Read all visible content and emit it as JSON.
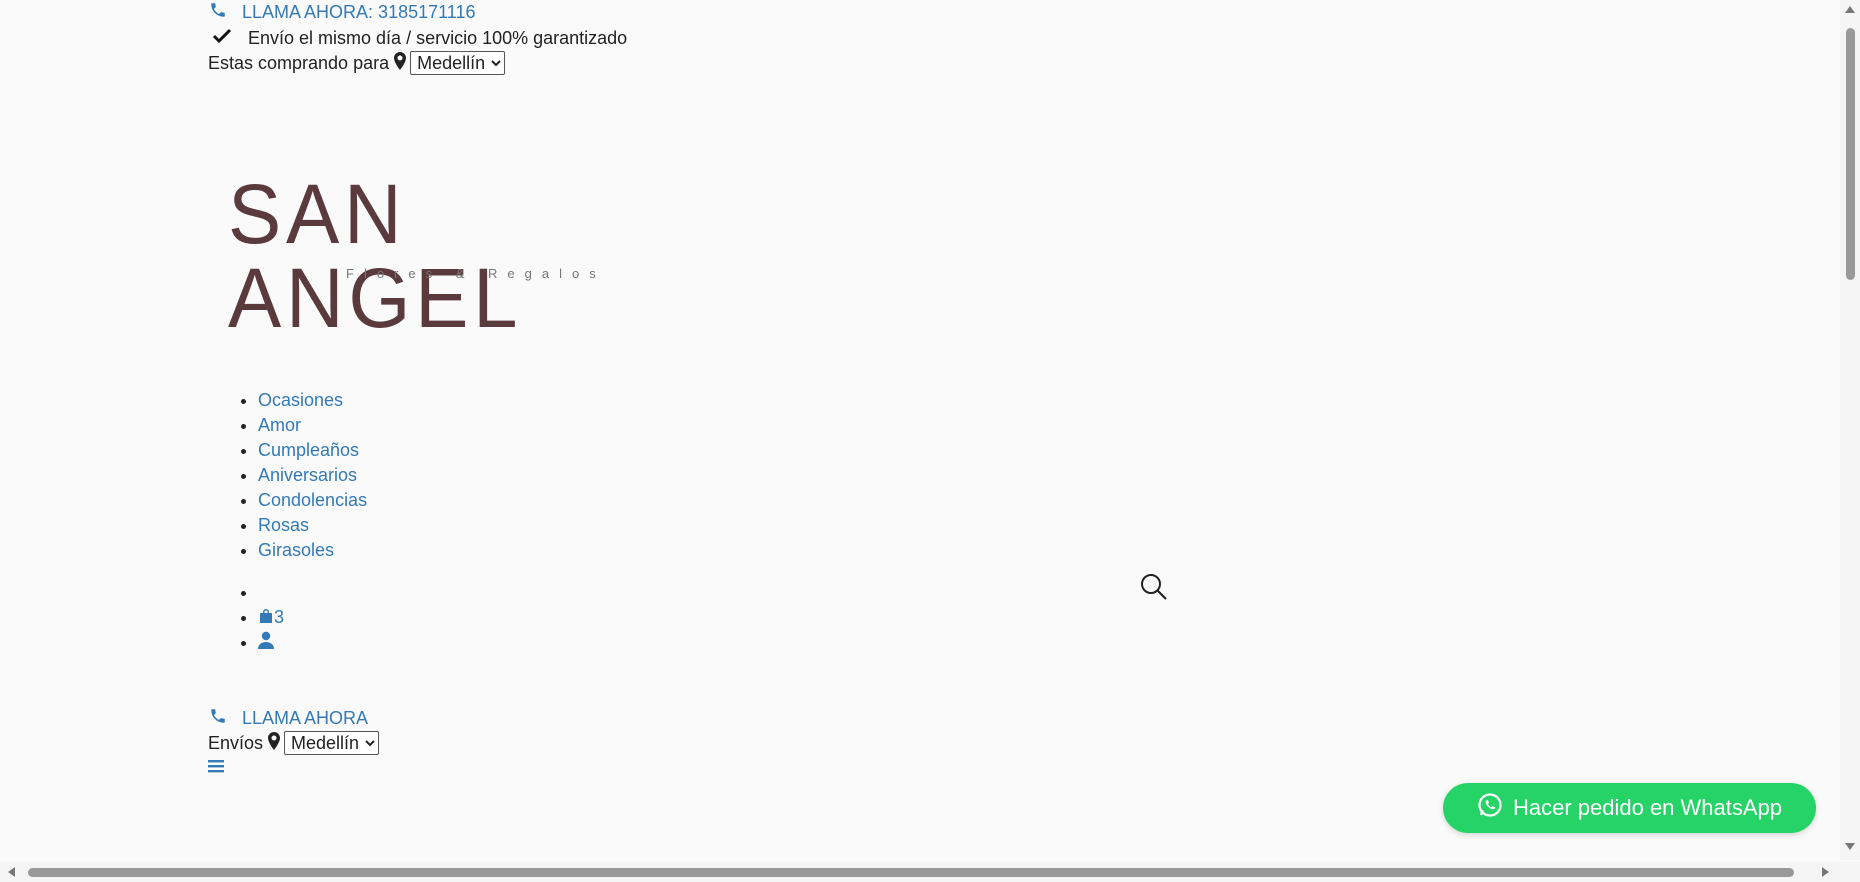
{
  "topbar": {
    "phone_label": "LLAMA AHORA: 3185171116",
    "shipping_text": "Envío el mismo día / servicio 100% garantizado",
    "buying_for_label": "Estas comprando para",
    "city_selected": "Medellín"
  },
  "logo": {
    "title": "SAN ANGEL",
    "subtitle": "Flores & Regalos"
  },
  "menu": {
    "items": [
      {
        "label": "Ocasiones"
      },
      {
        "label": "Amor"
      },
      {
        "label": "Cumpleaños"
      },
      {
        "label": "Aniversarios"
      },
      {
        "label": "Condolencias"
      },
      {
        "label": "Rosas"
      },
      {
        "label": "Girasoles"
      }
    ]
  },
  "icons_bar": {
    "search_icon": "search-icon",
    "cart_icon": "shopping-bag-icon",
    "cart_count": "3",
    "account_icon": "user-icon"
  },
  "mobile": {
    "call_label": "LLAMA AHORA",
    "shipping_label": "Envíos",
    "city_selected": "Medellín",
    "menu_icon": "hamburger-icon"
  },
  "whatsapp": {
    "label": "Hacer pedido en WhatsApp"
  },
  "colors": {
    "link": "#337ab7",
    "logo": "#5a3a3c",
    "whatsapp": "#25d366",
    "background": "#fafafa"
  }
}
